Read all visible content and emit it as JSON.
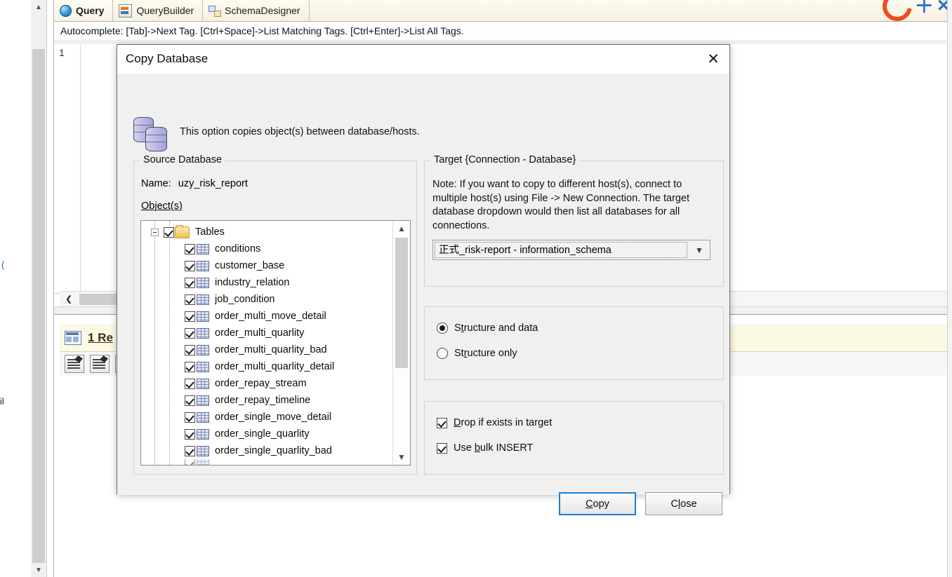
{
  "app": {
    "tabs": [
      {
        "label": "Query",
        "icon": "globe-icon",
        "active": true
      },
      {
        "label": "QueryBuilder",
        "icon": "query-builder-icon",
        "active": false
      },
      {
        "label": "SchemaDesigner",
        "icon": "schema-designer-icon",
        "active": false
      }
    ],
    "autocomplete_hint": "Autocomplete: [Tab]->Next Tag. [Ctrl+Space]->List Matching Tags. [Ctrl+Enter]->List All Tags.",
    "editor": {
      "line_number": "1"
    },
    "results": {
      "tab_label": "1 Re"
    }
  },
  "dialog": {
    "title": "Copy Database",
    "close_label": "✕",
    "description": "This option copies object(s) between database/hosts.",
    "source": {
      "legend": "Source Database",
      "name_label": "Name:",
      "name_value": "uzy_risk_report",
      "objects_label": "Object(s)",
      "tree": {
        "root": {
          "label": "Tables",
          "checked": true
        },
        "items": [
          {
            "label": "conditions",
            "checked": true
          },
          {
            "label": "customer_base",
            "checked": true
          },
          {
            "label": "industry_relation",
            "checked": true
          },
          {
            "label": "job_condition",
            "checked": true
          },
          {
            "label": "order_multi_move_detail",
            "checked": true
          },
          {
            "label": "order_multi_quarlity",
            "checked": true
          },
          {
            "label": "order_multi_quarlity_bad",
            "checked": true
          },
          {
            "label": "order_multi_quarlity_detail",
            "checked": true
          },
          {
            "label": "order_repay_stream",
            "checked": true
          },
          {
            "label": "order_repay_timeline",
            "checked": true
          },
          {
            "label": "order_single_move_detail",
            "checked": true
          },
          {
            "label": "order_single_quarlity",
            "checked": true
          },
          {
            "label": "order_single_quarlity_bad",
            "checked": true
          }
        ]
      }
    },
    "target": {
      "legend": "Target {Connection - Database}",
      "note": "Note: If you want to copy to different host(s), connect to multiple host(s) using  File -> New Connection. The target database dropdown would then list all databases for all connections.",
      "selected": "正式_risk-report - information_schema"
    },
    "mode": {
      "options": [
        {
          "label_pre": "S",
          "label_accel": "t",
          "label_post": "ructure and data",
          "selected": true
        },
        {
          "label_pre": "St",
          "label_accel": "r",
          "label_post": "ucture only",
          "selected": false
        }
      ]
    },
    "options": {
      "items": [
        {
          "label_pre": "",
          "label_accel": "D",
          "label_post": "rop if exists in target",
          "checked": true
        },
        {
          "label_pre": "Use ",
          "label_accel": "b",
          "label_post": "ulk INSERT",
          "checked": true
        }
      ]
    },
    "buttons": {
      "copy": {
        "pre": "",
        "accel": "C",
        "post": "opy",
        "default": true
      },
      "close": {
        "pre": "C",
        "accel": "l",
        "post": "ose",
        "default": false
      }
    }
  },
  "colors": {
    "dialog_bg": "#f0f0f0",
    "accent_focus": "#1a7fd4",
    "tab_bar": "#f5f1e0",
    "result_bar": "#fbf8e3"
  }
}
